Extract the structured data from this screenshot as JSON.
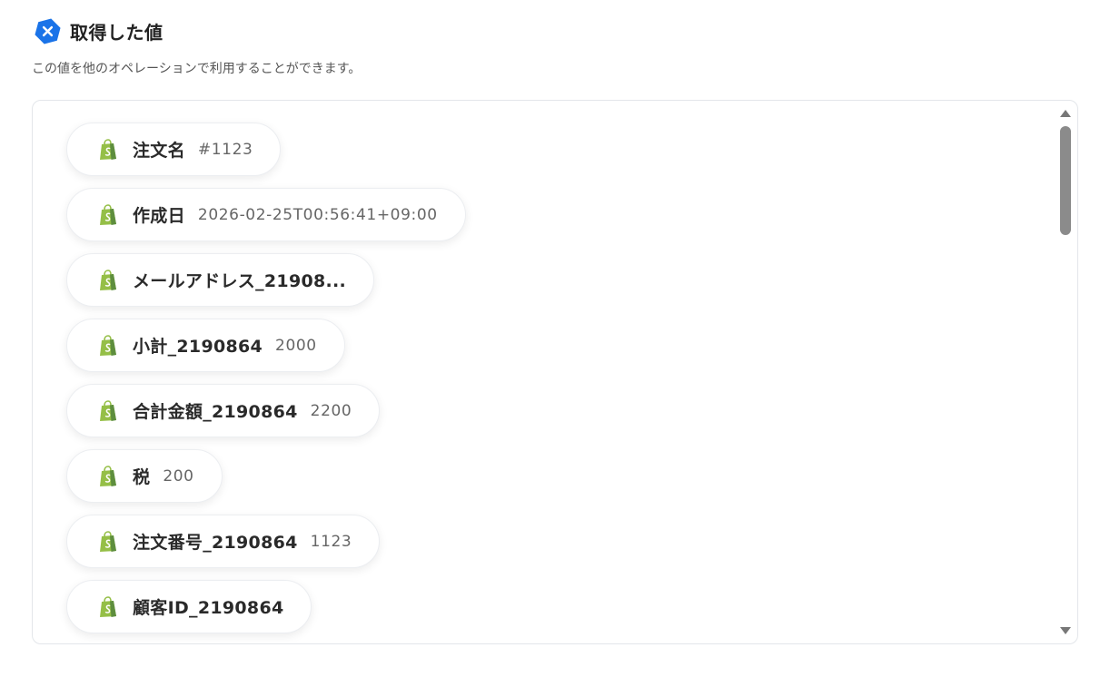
{
  "header": {
    "logo_icon": "yoom-hexagon-x-icon",
    "title": "取得した値"
  },
  "subtitle": "この値を他のオペレーションで利用することができます。",
  "colors": {
    "accent": "#1a73e8",
    "shopify_green": "#95bf47"
  },
  "values": [
    {
      "icon": "shopify-bag-icon",
      "label": "注文名",
      "value": "#1123"
    },
    {
      "icon": "shopify-bag-icon",
      "label": "作成日",
      "value": "2026-02-25T00:56:41+09:00"
    },
    {
      "icon": "shopify-bag-icon",
      "label": "メールアドレス_21908...",
      "value": ""
    },
    {
      "icon": "shopify-bag-icon",
      "label": "小計_2190864",
      "value": "2000"
    },
    {
      "icon": "shopify-bag-icon",
      "label": "合計金額_2190864",
      "value": "2200"
    },
    {
      "icon": "shopify-bag-icon",
      "label": "税",
      "value": "200"
    },
    {
      "icon": "shopify-bag-icon",
      "label": "注文番号_2190864",
      "value": "1123"
    },
    {
      "icon": "shopify-bag-icon",
      "label": "顧客ID_2190864",
      "value": ""
    }
  ]
}
